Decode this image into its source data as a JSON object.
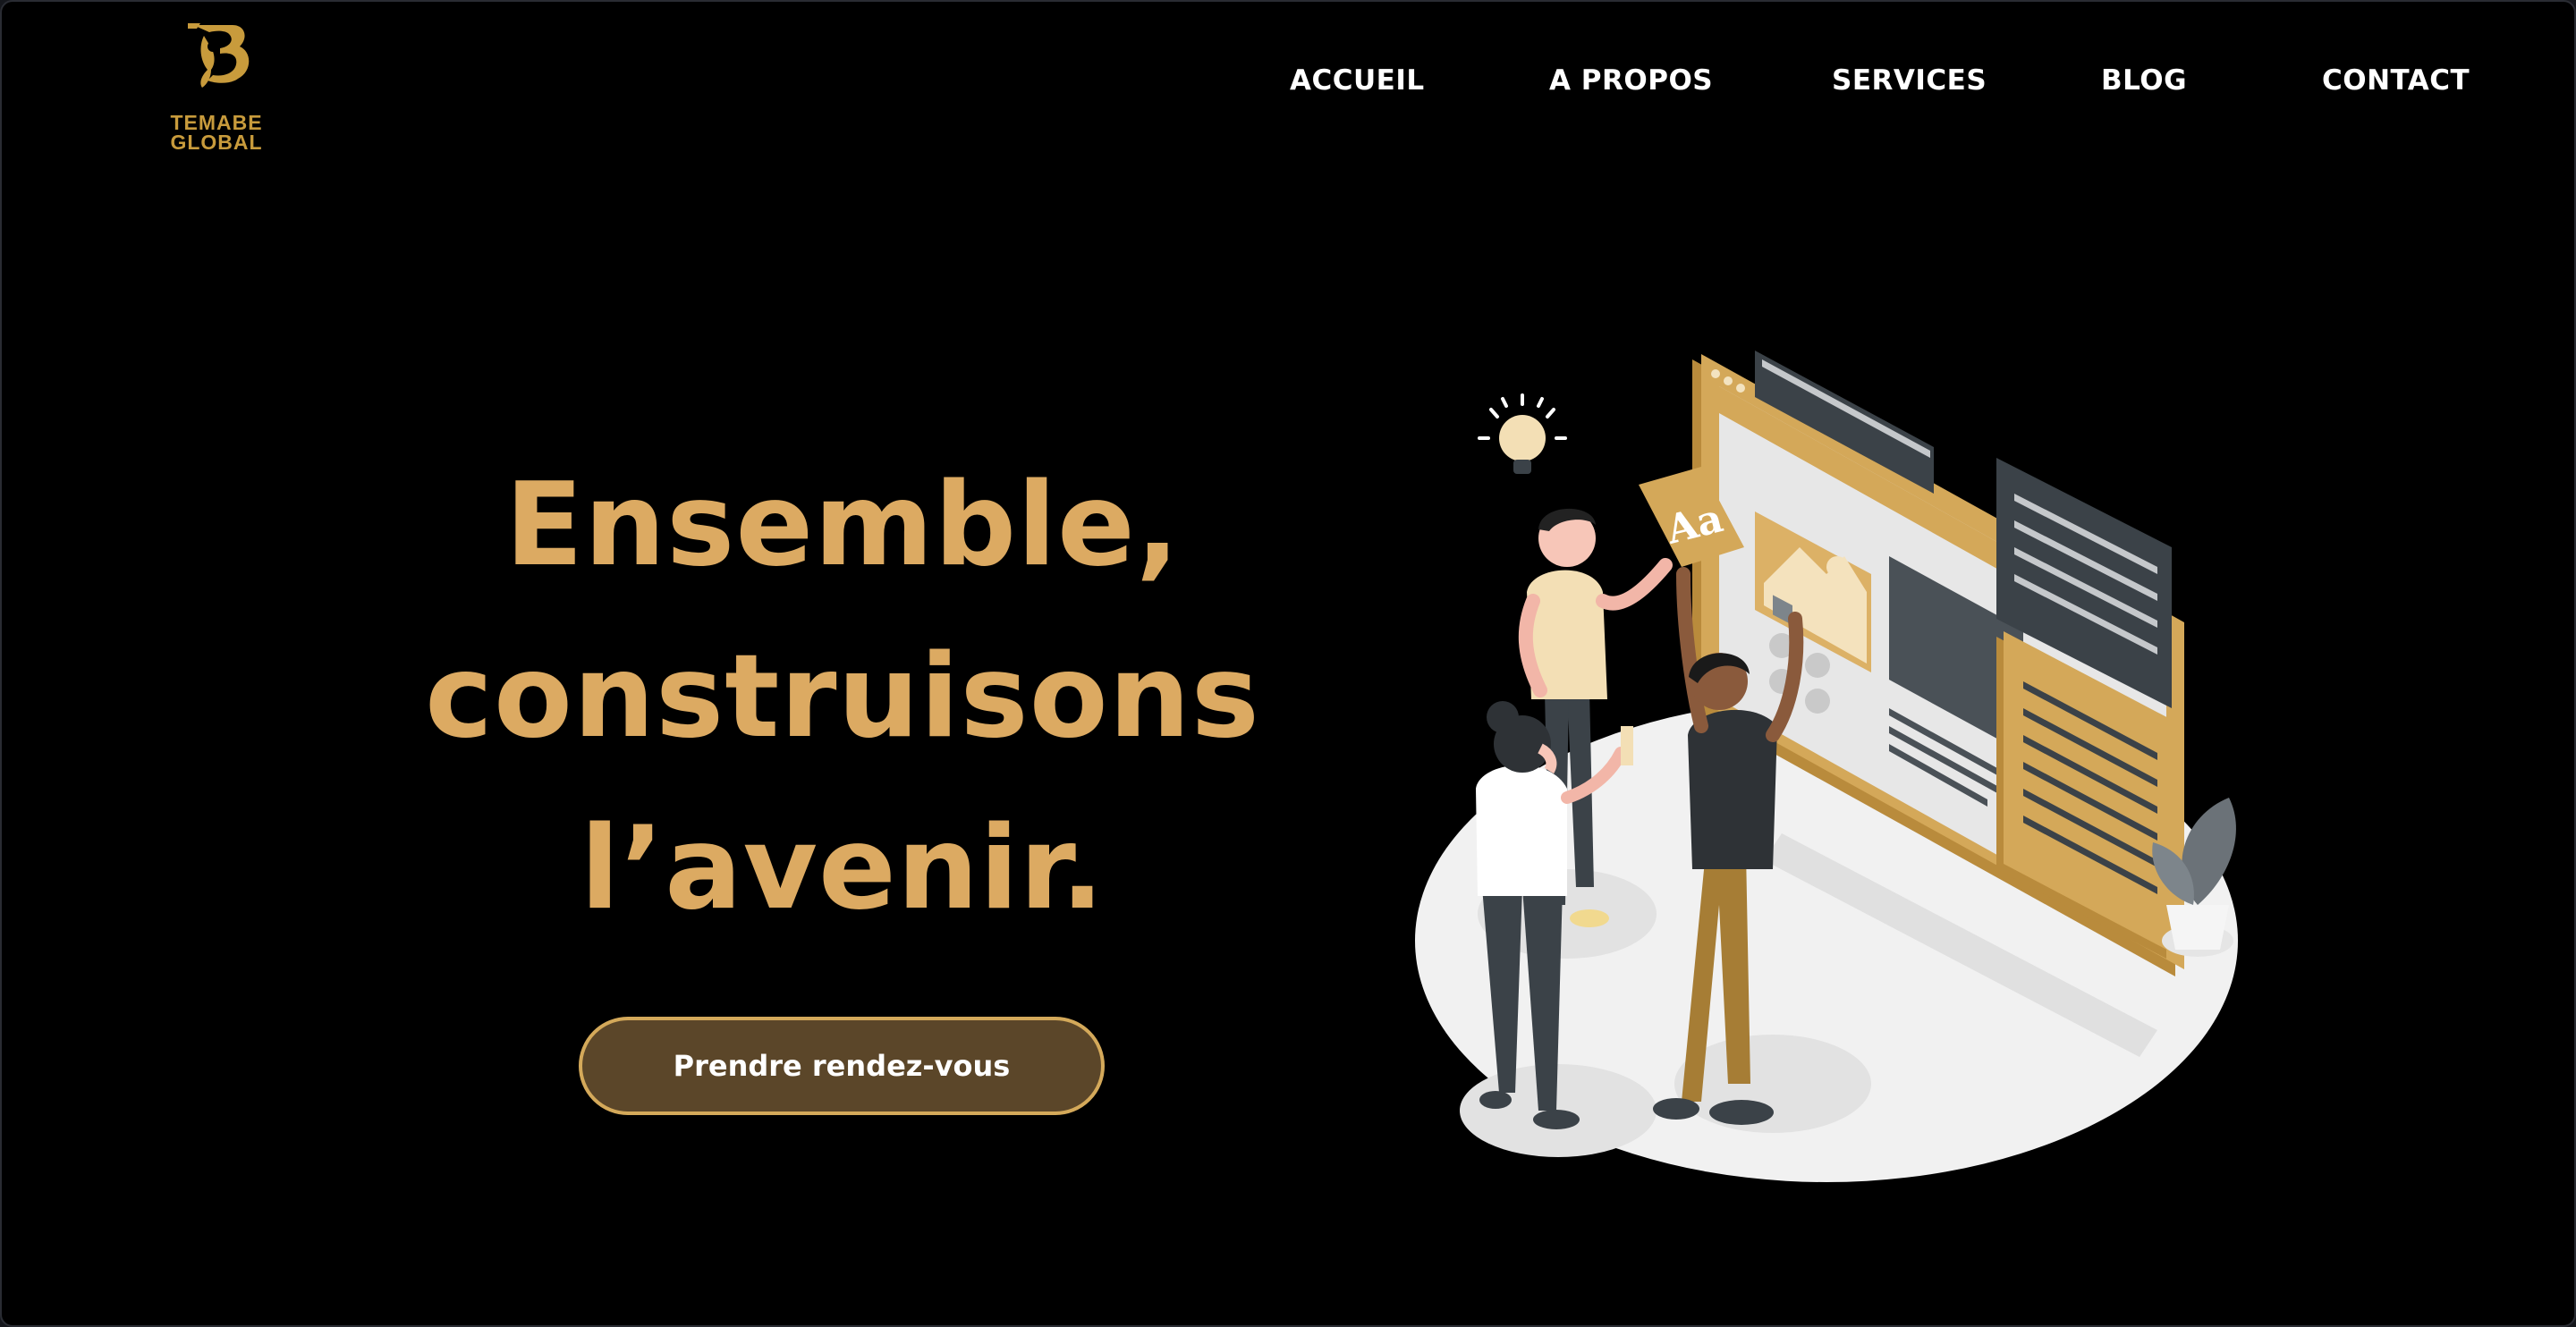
{
  "brand": {
    "logo_line1": "TEMABE",
    "logo_line2": "GLOBAL",
    "gold": "#c89b3c"
  },
  "nav": {
    "items": [
      {
        "label": "ACCUEIL"
      },
      {
        "label": "A PROPOS"
      },
      {
        "label": "SERVICES"
      },
      {
        "label": "BLOG"
      },
      {
        "label": "CONTACT"
      }
    ]
  },
  "hero": {
    "title_line1": "Ensemble,",
    "title_line2": "construisons",
    "title_line3": "l’avenir.",
    "cta_label": "Prendre rendez-vous",
    "title_color": "#dcaa62",
    "cta_bg": "#5b4629",
    "cta_border": "#d4a95a"
  },
  "illustration": {
    "font_sample_label": "Aa"
  }
}
